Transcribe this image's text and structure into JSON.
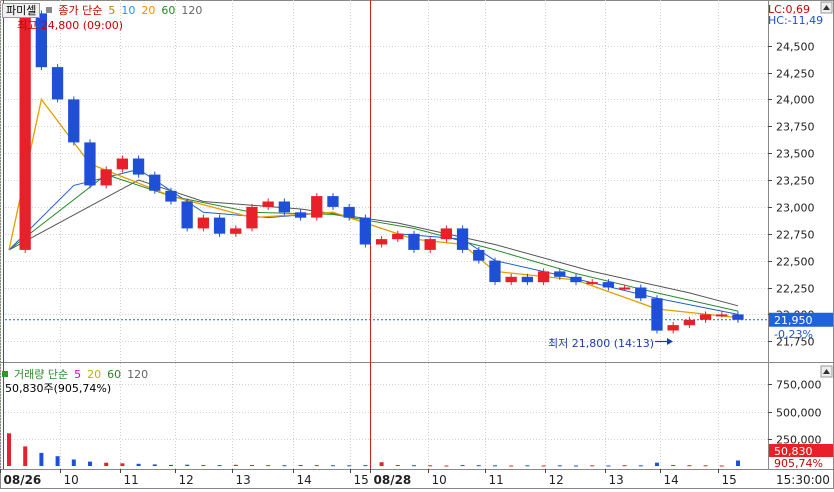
{
  "legend": {
    "period_button": "파미셀",
    "series_label": "종가 단순",
    "ma_periods": [
      "5",
      "10",
      "20",
      "60",
      "120"
    ],
    "ma_colors": [
      "#b8860b",
      "#1e90ff",
      "#ff8c00",
      "#228b22",
      "#888888"
    ]
  },
  "volume_legend": {
    "label": "거래량 단순",
    "periods": [
      "5",
      "20",
      "60",
      "120"
    ],
    "colors": [
      "#cc00cc",
      "#b8b800",
      "#228b22",
      "#888888"
    ],
    "current_text": "50,830주(905,74%)"
  },
  "annotations": {
    "high": "최고 24,800 (09:00)",
    "low": "최저 21,800 (14:13)",
    "lc": "LC:0,69",
    "hc": "HC:-11,49",
    "current_price": "21,950",
    "current_change": "-0,23%",
    "volume_current": "50,830",
    "volume_pct": "905,74%",
    "time_label": "15:30:00"
  },
  "colors": {
    "up": "#e8202a",
    "down": "#1f4fd6",
    "price_tag_bg": "#1f63d8",
    "volume_tag_bg": "#e8202a",
    "grid": "#d0d0d0",
    "day_divider": "#cc2222"
  },
  "chart_data": {
    "type": "candlestick",
    "price_axis": {
      "ticks": [
        "24,500",
        "24,250",
        "24,000",
        "23,750",
        "23,500",
        "23,250",
        "23,000",
        "22,750",
        "22,500",
        "22,250",
        "22,000",
        "21,750"
      ],
      "range": [
        21650,
        24850
      ]
    },
    "volume_axis": {
      "ticks": [
        "750,000",
        "500,000",
        "250,000"
      ],
      "range": [
        0,
        900000
      ]
    },
    "x_labels": [
      "08/26",
      "10",
      "11",
      "12",
      "13",
      "14",
      "15",
      "08/28",
      "10",
      "11",
      "12",
      "13",
      "14",
      "15"
    ],
    "close_path": [
      [
        0,
        22600
      ],
      [
        1,
        24800
      ],
      [
        2,
        24300
      ],
      [
        3,
        24000
      ],
      [
        4,
        23600
      ],
      [
        5,
        23200
      ],
      [
        6,
        23350
      ],
      [
        7,
        23450
      ],
      [
        8,
        23300
      ],
      [
        9,
        23150
      ],
      [
        10,
        23050
      ],
      [
        11,
        22800
      ],
      [
        12,
        22900
      ],
      [
        13,
        22750
      ],
      [
        14,
        22800
      ],
      [
        15,
        23000
      ],
      [
        16,
        23050
      ],
      [
        17,
        22950
      ],
      [
        18,
        22900
      ],
      [
        19,
        23100
      ],
      [
        20,
        23000
      ],
      [
        21,
        22900
      ],
      [
        22,
        22650
      ],
      [
        23,
        22700
      ],
      [
        24,
        22750
      ],
      [
        25,
        22600
      ],
      [
        26,
        22700
      ],
      [
        27,
        22800
      ],
      [
        28,
        22600
      ],
      [
        29,
        22500
      ],
      [
        30,
        22300
      ],
      [
        31,
        22350
      ],
      [
        32,
        22300
      ],
      [
        33,
        22400
      ],
      [
        34,
        22350
      ],
      [
        35,
        22300
      ],
      [
        36,
        22300
      ],
      [
        37,
        22250
      ],
      [
        38,
        22250
      ],
      [
        39,
        22150
      ],
      [
        40,
        21850
      ],
      [
        41,
        21900
      ],
      [
        42,
        21950
      ],
      [
        43,
        22000
      ],
      [
        44,
        22000
      ],
      [
        45,
        21950
      ]
    ],
    "ma5": [
      [
        0,
        22600
      ],
      [
        2,
        24000
      ],
      [
        5,
        23400
      ],
      [
        10,
        23100
      ],
      [
        15,
        22900
      ],
      [
        20,
        22950
      ],
      [
        25,
        22700
      ],
      [
        28,
        22650
      ],
      [
        30,
        22400
      ],
      [
        35,
        22320
      ],
      [
        40,
        22050
      ],
      [
        45,
        21970
      ]
    ],
    "ma20": [
      [
        0,
        22600
      ],
      [
        4,
        23200
      ],
      [
        8,
        23350
      ],
      [
        12,
        22950
      ],
      [
        16,
        22900
      ],
      [
        20,
        22950
      ],
      [
        24,
        22750
      ],
      [
        28,
        22700
      ],
      [
        30,
        22500
      ],
      [
        35,
        22330
      ],
      [
        40,
        22150
      ],
      [
        45,
        22000
      ]
    ],
    "ma60": [
      [
        0,
        22600
      ],
      [
        6,
        23300
      ],
      [
        10,
        23100
      ],
      [
        15,
        22950
      ],
      [
        20,
        22930
      ],
      [
        25,
        22800
      ],
      [
        30,
        22600
      ],
      [
        35,
        22380
      ],
      [
        40,
        22200
      ],
      [
        45,
        22030
      ]
    ],
    "ma120": [
      [
        0,
        22600
      ],
      [
        8,
        23250
      ],
      [
        12,
        23050
      ],
      [
        18,
        22980
      ],
      [
        24,
        22850
      ],
      [
        30,
        22650
      ],
      [
        36,
        22400
      ],
      [
        42,
        22200
      ],
      [
        45,
        22080
      ]
    ],
    "volume": [
      [
        0,
        300000
      ],
      [
        1,
        180000
      ],
      [
        2,
        120000
      ],
      [
        3,
        90000
      ],
      [
        4,
        60000
      ],
      [
        5,
        40000
      ],
      [
        6,
        30000
      ],
      [
        7,
        25000
      ],
      [
        8,
        20000
      ],
      [
        9,
        15000
      ],
      [
        10,
        10000
      ],
      [
        11,
        12000
      ],
      [
        12,
        9000
      ],
      [
        13,
        8000
      ],
      [
        14,
        11000
      ],
      [
        15,
        9000
      ],
      [
        16,
        8000
      ],
      [
        17,
        7000
      ],
      [
        18,
        9000
      ],
      [
        19,
        8000
      ],
      [
        20,
        7000
      ],
      [
        21,
        6000
      ],
      [
        22,
        8000
      ],
      [
        23,
        35000
      ],
      [
        24,
        9000
      ],
      [
        25,
        7000
      ],
      [
        26,
        6000
      ],
      [
        27,
        5000
      ],
      [
        28,
        8000
      ],
      [
        29,
        7000
      ],
      [
        30,
        6000
      ],
      [
        31,
        5000
      ],
      [
        32,
        6000
      ],
      [
        33,
        5000
      ],
      [
        34,
        6000
      ],
      [
        35,
        5000
      ],
      [
        36,
        6000
      ],
      [
        37,
        5000
      ],
      [
        38,
        7000
      ],
      [
        39,
        6000
      ],
      [
        40,
        30000
      ],
      [
        41,
        9000
      ],
      [
        42,
        7000
      ],
      [
        43,
        6000
      ],
      [
        44,
        5000
      ],
      [
        45,
        50830
      ]
    ]
  }
}
